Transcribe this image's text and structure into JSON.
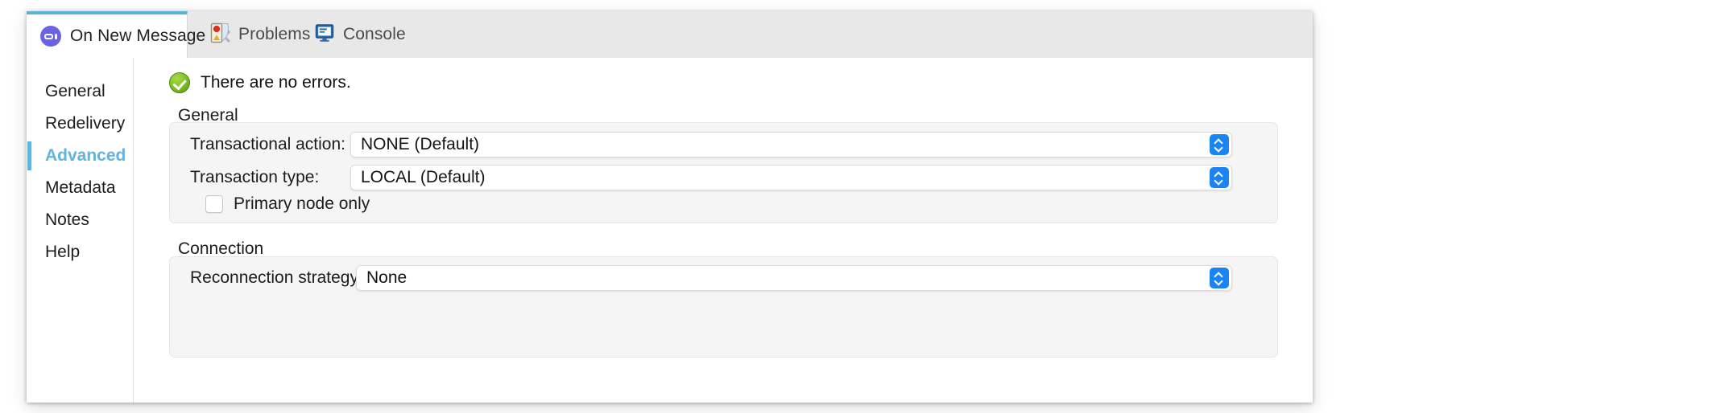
{
  "tabs": [
    {
      "label": "On New Message",
      "icon": "listener-icon",
      "active": true,
      "closable": true
    },
    {
      "label": "Problems",
      "icon": "problems-icon",
      "active": false,
      "closable": false
    },
    {
      "label": "Console",
      "icon": "console-icon",
      "active": false,
      "closable": false
    }
  ],
  "sidebar": {
    "items": [
      {
        "label": "General",
        "active": false
      },
      {
        "label": "Redelivery",
        "active": false
      },
      {
        "label": "Advanced",
        "active": true
      },
      {
        "label": "Metadata",
        "active": false
      },
      {
        "label": "Notes",
        "active": false
      },
      {
        "label": "Help",
        "active": false
      }
    ]
  },
  "status": {
    "icon": "success-check-icon",
    "text": "There are no errors."
  },
  "sections": {
    "general": {
      "title": "General",
      "fields": [
        {
          "label": "Transactional action:",
          "value": "NONE (Default)",
          "control": "combobox"
        },
        {
          "label": "Transaction type:",
          "value": "LOCAL (Default)",
          "control": "combobox"
        }
      ],
      "checkbox": {
        "label": "Primary node only",
        "checked": false
      }
    },
    "connection": {
      "title": "Connection",
      "fields": [
        {
          "label": "Reconnection strategy",
          "value": "None",
          "control": "combobox"
        }
      ]
    }
  },
  "colors": {
    "accent": "#62b4e0",
    "tab_accent": "#5bb3dd",
    "stepper_blue": "#1a84f5",
    "success_green": "#84c425"
  }
}
